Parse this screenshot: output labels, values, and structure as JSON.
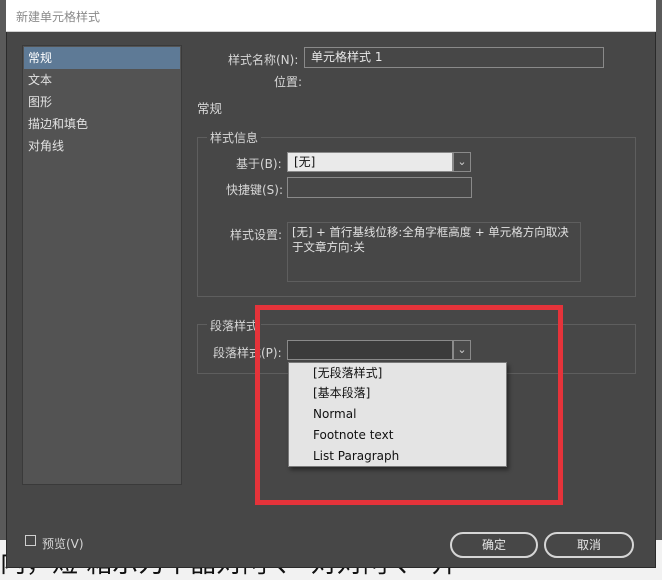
{
  "window": {
    "title": "新建单元格样式"
  },
  "sidebar": {
    "items": [
      {
        "label": "常规"
      },
      {
        "label": "文本"
      },
      {
        "label": "图形"
      },
      {
        "label": "描边和填色"
      },
      {
        "label": "对角线"
      }
    ]
  },
  "general": {
    "style_name_label": "样式名称(N):",
    "style_name_value": "单元格样式 1",
    "location_label": "位置:",
    "section_title": "常规"
  },
  "style_info": {
    "group_title": "样式信息",
    "based_on_label": "基于(B):",
    "based_on_value": "[无]",
    "shortcut_label": "快捷键(S):",
    "shortcut_value": "",
    "settings_label": "样式设置:",
    "settings_text": "[无] + 首行基线位移:全角字框高度 + 单元格方向取决于文章方向:关"
  },
  "paragraph": {
    "group_title": "段落样式",
    "style_label": "段落样式(P):",
    "options": [
      "[无段落样式]",
      "[基本段落]",
      "Normal",
      "Footnote text",
      "List Paragraph"
    ]
  },
  "footer": {
    "preview_label": "预览(V)",
    "ok_label": "确定",
    "cancel_label": "取消"
  },
  "background_text": "内，短   箱示为中晶对阿   、   对对阿   、   开",
  "colors": {
    "highlight": "#e5333a",
    "selected": "#5e7a96"
  },
  "icons": {
    "dropdown_arrow": "chevron-down-icon"
  }
}
